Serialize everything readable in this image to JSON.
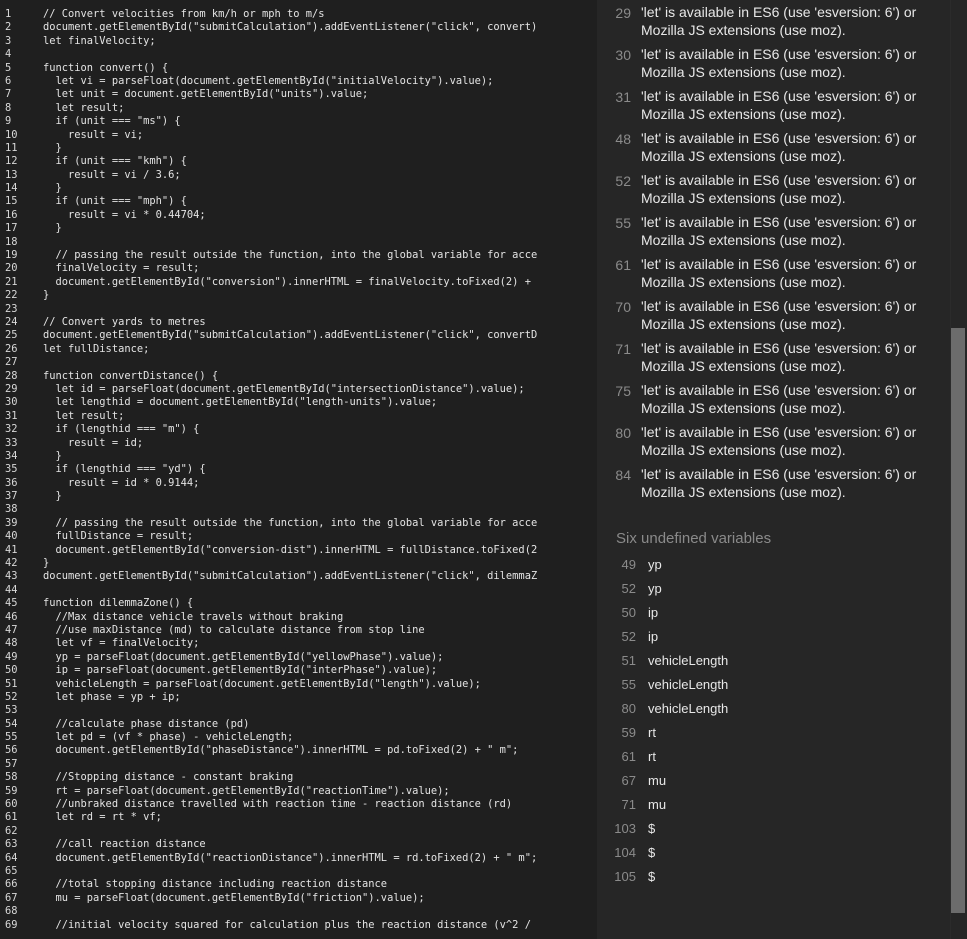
{
  "code_lines": [
    {
      "n": "1",
      "t": "// Convert velocities from km/h or mph to m/s"
    },
    {
      "n": "2",
      "t": "document.getElementById(\"submitCalculation\").addEventListener(\"click\", convert)"
    },
    {
      "n": "3",
      "t": "let finalVelocity;"
    },
    {
      "n": "4",
      "t": ""
    },
    {
      "n": "5",
      "t": "function convert() {"
    },
    {
      "n": "6",
      "t": "  let vi = parseFloat(document.getElementById(\"initialVelocity\").value);"
    },
    {
      "n": "7",
      "t": "  let unit = document.getElementById(\"units\").value;"
    },
    {
      "n": "8",
      "t": "  let result;"
    },
    {
      "n": "9",
      "t": "  if (unit === \"ms\") {"
    },
    {
      "n": "10",
      "t": "    result = vi;"
    },
    {
      "n": "11",
      "t": "  }"
    },
    {
      "n": "12",
      "t": "  if (unit === \"kmh\") {"
    },
    {
      "n": "13",
      "t": "    result = vi / 3.6;"
    },
    {
      "n": "14",
      "t": "  }"
    },
    {
      "n": "15",
      "t": "  if (unit === \"mph\") {"
    },
    {
      "n": "16",
      "t": "    result = vi * 0.44704;"
    },
    {
      "n": "17",
      "t": "  }"
    },
    {
      "n": "18",
      "t": ""
    },
    {
      "n": "19",
      "t": "  // passing the result outside the function, into the global variable for acce"
    },
    {
      "n": "20",
      "t": "  finalVelocity = result;"
    },
    {
      "n": "21",
      "t": "  document.getElementById(\"conversion\").innerHTML = finalVelocity.toFixed(2) +"
    },
    {
      "n": "22",
      "t": "}"
    },
    {
      "n": "23",
      "t": ""
    },
    {
      "n": "24",
      "t": "// Convert yards to metres"
    },
    {
      "n": "25",
      "t": "document.getElementById(\"submitCalculation\").addEventListener(\"click\", convertD"
    },
    {
      "n": "26",
      "t": "let fullDistance;"
    },
    {
      "n": "27",
      "t": ""
    },
    {
      "n": "28",
      "t": "function convertDistance() {"
    },
    {
      "n": "29",
      "t": "  let id = parseFloat(document.getElementById(\"intersectionDistance\").value);"
    },
    {
      "n": "30",
      "t": "  let lengthid = document.getElementById(\"length-units\").value;"
    },
    {
      "n": "31",
      "t": "  let result;"
    },
    {
      "n": "32",
      "t": "  if (lengthid === \"m\") {"
    },
    {
      "n": "33",
      "t": "    result = id;"
    },
    {
      "n": "34",
      "t": "  }"
    },
    {
      "n": "35",
      "t": "  if (lengthid === \"yd\") {"
    },
    {
      "n": "36",
      "t": "    result = id * 0.9144;"
    },
    {
      "n": "37",
      "t": "  }"
    },
    {
      "n": "38",
      "t": ""
    },
    {
      "n": "39",
      "t": "  // passing the result outside the function, into the global variable for acce"
    },
    {
      "n": "40",
      "t": "  fullDistance = result;"
    },
    {
      "n": "41",
      "t": "  document.getElementById(\"conversion-dist\").innerHTML = fullDistance.toFixed(2"
    },
    {
      "n": "42",
      "t": "}"
    },
    {
      "n": "43",
      "t": "document.getElementById(\"submitCalculation\").addEventListener(\"click\", dilemmaZ"
    },
    {
      "n": "44",
      "t": ""
    },
    {
      "n": "45",
      "t": "function dilemmaZone() {"
    },
    {
      "n": "46",
      "t": "  //Max distance vehicle travels without braking"
    },
    {
      "n": "47",
      "t": "  //use maxDistance (md) to calculate distance from stop line"
    },
    {
      "n": "48",
      "t": "  let vf = finalVelocity;"
    },
    {
      "n": "49",
      "t": "  yp = parseFloat(document.getElementById(\"yellowPhase\").value);"
    },
    {
      "n": "50",
      "t": "  ip = parseFloat(document.getElementById(\"interPhase\").value);"
    },
    {
      "n": "51",
      "t": "  vehicleLength = parseFloat(document.getElementById(\"length\").value);"
    },
    {
      "n": "52",
      "t": "  let phase = yp + ip;"
    },
    {
      "n": "53",
      "t": ""
    },
    {
      "n": "54",
      "t": "  //calculate phase distance (pd)"
    },
    {
      "n": "55",
      "t": "  let pd = (vf * phase) - vehicleLength;"
    },
    {
      "n": "56",
      "t": "  document.getElementById(\"phaseDistance\").innerHTML = pd.toFixed(2) + \" m\";"
    },
    {
      "n": "57",
      "t": ""
    },
    {
      "n": "58",
      "t": "  //Stopping distance - constant braking"
    },
    {
      "n": "59",
      "t": "  rt = parseFloat(document.getElementById(\"reactionTime\").value);"
    },
    {
      "n": "60",
      "t": "  //unbraked distance travelled with reaction time - reaction distance (rd)"
    },
    {
      "n": "61",
      "t": "  let rd = rt * vf;"
    },
    {
      "n": "62",
      "t": ""
    },
    {
      "n": "63",
      "t": "  //call reaction distance"
    },
    {
      "n": "64",
      "t": "  document.getElementById(\"reactionDistance\").innerHTML = rd.toFixed(2) + \" m\";"
    },
    {
      "n": "65",
      "t": ""
    },
    {
      "n": "66",
      "t": "  //total stopping distance including reaction distance"
    },
    {
      "n": "67",
      "t": "  mu = parseFloat(document.getElementById(\"friction\").value);"
    },
    {
      "n": "68",
      "t": ""
    },
    {
      "n": "69",
      "t": "  //initial velocity squared for calculation plus the reaction distance (v^2 /"
    }
  ],
  "warnings": [
    {
      "line": "29",
      "text": "'let' is available in ES6 (use 'esversion: 6') or Mozilla JS extensions (use moz)."
    },
    {
      "line": "30",
      "text": "'let' is available in ES6 (use 'esversion: 6') or Mozilla JS extensions (use moz)."
    },
    {
      "line": "31",
      "text": "'let' is available in ES6 (use 'esversion: 6') or Mozilla JS extensions (use moz)."
    },
    {
      "line": "48",
      "text": "'let' is available in ES6 (use 'esversion: 6') or Mozilla JS extensions (use moz)."
    },
    {
      "line": "52",
      "text": "'let' is available in ES6 (use 'esversion: 6') or Mozilla JS extensions (use moz)."
    },
    {
      "line": "55",
      "text": "'let' is available in ES6 (use 'esversion: 6') or Mozilla JS extensions (use moz)."
    },
    {
      "line": "61",
      "text": "'let' is available in ES6 (use 'esversion: 6') or Mozilla JS extensions (use moz)."
    },
    {
      "line": "70",
      "text": "'let' is available in ES6 (use 'esversion: 6') or Mozilla JS extensions (use moz)."
    },
    {
      "line": "71",
      "text": "'let' is available in ES6 (use 'esversion: 6') or Mozilla JS extensions (use moz)."
    },
    {
      "line": "75",
      "text": "'let' is available in ES6 (use 'esversion: 6') or Mozilla JS extensions (use moz)."
    },
    {
      "line": "80",
      "text": "'let' is available in ES6 (use 'esversion: 6') or Mozilla JS extensions (use moz)."
    },
    {
      "line": "84",
      "text": "'let' is available in ES6 (use 'esversion: 6') or Mozilla JS extensions (use moz)."
    }
  ],
  "undefined_section": {
    "title": "Six undefined variables",
    "items": [
      {
        "line": "49",
        "name": "yp"
      },
      {
        "line": "52",
        "name": "yp"
      },
      {
        "line": "50",
        "name": "ip"
      },
      {
        "line": "52",
        "name": "ip"
      },
      {
        "line": "51",
        "name": "vehicleLength"
      },
      {
        "line": "55",
        "name": "vehicleLength"
      },
      {
        "line": "80",
        "name": "vehicleLength"
      },
      {
        "line": "59",
        "name": "rt"
      },
      {
        "line": "61",
        "name": "rt"
      },
      {
        "line": "67",
        "name": "mu"
      },
      {
        "line": "71",
        "name": "mu"
      },
      {
        "line": "103",
        "name": "$"
      },
      {
        "line": "104",
        "name": "$"
      },
      {
        "line": "105",
        "name": "$"
      }
    ]
  },
  "colors": {
    "editor_bg": "#1f1f1f",
    "panel_bg": "#262626",
    "scroll_thumb": "#6c6c6c"
  }
}
